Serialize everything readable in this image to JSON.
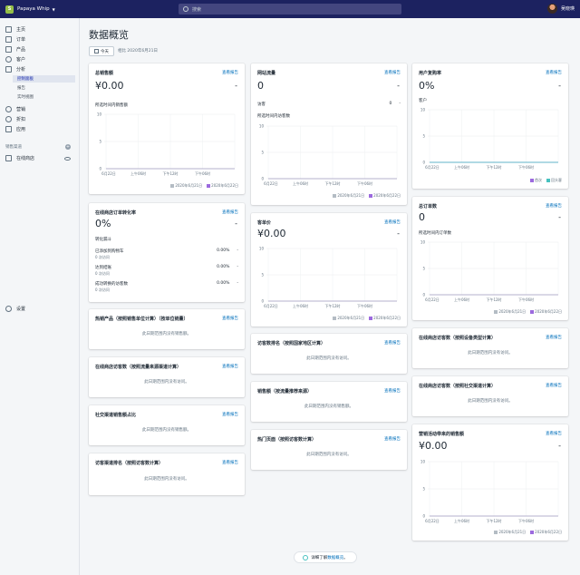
{
  "topbar": {
    "store_name": "Papaya Whip",
    "search_placeholder": "搜索",
    "user_name": "吴晓瑛"
  },
  "sidebar": {
    "items": [
      {
        "label": "主页",
        "icon": "home-icon"
      },
      {
        "label": "订单",
        "icon": "orders-icon"
      },
      {
        "label": "产品",
        "icon": "tag-icon"
      },
      {
        "label": "客户",
        "icon": "customers-icon"
      },
      {
        "label": "分析",
        "icon": "analytics-icon"
      },
      {
        "label": "营销",
        "icon": "marketing-icon"
      },
      {
        "label": "折扣",
        "icon": "discount-icon"
      },
      {
        "label": "应用",
        "icon": "apps-icon"
      }
    ],
    "sub_items": [
      "控制面板",
      "报告",
      "实时视图"
    ],
    "sales_channels_title": "销售渠道",
    "online_store": "在线商店",
    "settings": "设置"
  },
  "page": {
    "title": "数据概览",
    "date_button": "今天",
    "compare_text": "相比 2020年6月21日"
  },
  "common": {
    "view_report": "查看报告",
    "no_sales": "此日期范围内没有销售额。",
    "no_visits": "此日期范围内没有访问。",
    "legend_a": "2020年6月21日",
    "legend_b": "2020年6月22日",
    "dash": "-"
  },
  "cards": {
    "total_sales": {
      "title": "总销售额",
      "value": "¥0.00",
      "chart_label": "所选时间内销售额"
    },
    "traffic": {
      "title": "网站流量",
      "value": "0",
      "visitors_label": "访客",
      "visitors_value": "0",
      "chart_label": "所选时间内访客数"
    },
    "returning": {
      "title": "用户复购率",
      "value": "0%",
      "sub_label": "客户",
      "legend_a": "首次",
      "legend_b": "回头客"
    },
    "conversion": {
      "title": "在线商店订单转化率",
      "value": "0%",
      "funnel_title": "转化漏斗",
      "rows": [
        {
          "label": "已添加到购物车",
          "sub": "0 次访问",
          "pct": "0.00%"
        },
        {
          "label": "达到结账",
          "sub": "0 次访问",
          "pct": "0.00%"
        },
        {
          "label": "成功转换的访客数",
          "sub": "0 次访问",
          "pct": "0.00%"
        }
      ]
    },
    "aov": {
      "title": "客单价",
      "value": "¥0.00"
    },
    "total_orders": {
      "title": "总订单数",
      "value": "0",
      "chart_label": "所选时间内订单数"
    },
    "top_products": {
      "title": "热销产品（按照销售单位计算）（按单位销量）"
    },
    "visits_by_country": {
      "title": "访客数排名（按照国家地区计算）"
    },
    "visits_by_device": {
      "title": "在线商店访客数（按照设备类型计算）"
    },
    "visits_by_source": {
      "title": "在线商店访客数（按照流量来源渠道计算）"
    },
    "sales_by_referrer": {
      "title": "销售额（按流量推荐来源）"
    },
    "visits_by_social": {
      "title": "在线商店访客数（按照社交渠道计算）"
    },
    "social_sales": {
      "title": "社交渠道销售额占比"
    },
    "top_pages": {
      "title": "热门页面（按照访客数计算）"
    },
    "marketing_sales": {
      "title": "营销活动带来的销售额",
      "value": "¥0.00"
    },
    "visits_by_referrer": {
      "title": "访客渠道排名（按照访客数计算）"
    }
  },
  "chart_data": [
    {
      "id": "total_sales",
      "type": "line",
      "x": [
        "6月22日",
        "上午06时",
        "下午12时",
        "下午06时"
      ],
      "ylim": [
        0,
        10
      ],
      "yticks": [
        0,
        5,
        10
      ],
      "series": [
        {
          "name": "2020年6月21日",
          "values": [
            0,
            0,
            0,
            0
          ],
          "color": "#9c6ade"
        },
        {
          "name": "2020年6月22日",
          "values": [
            0,
            0,
            0,
            0
          ],
          "color": "#b4bcc4"
        }
      ]
    },
    {
      "id": "traffic",
      "type": "line",
      "x": [
        "6月22日",
        "上午06时",
        "下午12时",
        "下午06时"
      ],
      "ylim": [
        0,
        10
      ],
      "yticks": [
        0,
        5,
        10
      ],
      "series": [
        {
          "name": "2020年6月21日",
          "values": [
            0,
            0,
            0,
            0
          ],
          "color": "#9c6ade"
        },
        {
          "name": "2020年6月22日",
          "values": [
            0,
            0,
            0,
            0
          ],
          "color": "#b4bcc4"
        }
      ]
    },
    {
      "id": "returning",
      "type": "line",
      "x": [
        "6月22日",
        "上午06时",
        "下午12时",
        "下午06时"
      ],
      "ylim": [
        0,
        10
      ],
      "yticks": [
        0,
        5,
        10
      ],
      "series": [
        {
          "name": "首次",
          "values": [
            0,
            0,
            0,
            0
          ],
          "color": "#9c6ade"
        },
        {
          "name": "回头客",
          "values": [
            0,
            0,
            0,
            0
          ],
          "color": "#47c1bf"
        }
      ]
    },
    {
      "id": "aov",
      "type": "line",
      "x": [
        "6月22日",
        "上午06时",
        "下午12时",
        "下午06时"
      ],
      "ylim": [
        0,
        10
      ],
      "yticks": [
        0,
        5,
        10
      ],
      "series": [
        {
          "name": "2020年6月21日",
          "values": [
            0,
            0,
            0,
            0
          ],
          "color": "#9c6ade"
        },
        {
          "name": "2020年6月22日",
          "values": [
            0,
            0,
            0,
            0
          ],
          "color": "#b4bcc4"
        }
      ]
    },
    {
      "id": "total_orders",
      "type": "line",
      "x": [
        "6月22日",
        "上午06时",
        "下午12时",
        "下午06时"
      ],
      "ylim": [
        0,
        10
      ],
      "yticks": [
        0,
        5,
        10
      ],
      "series": [
        {
          "name": "2020年6月21日",
          "values": [
            0,
            0,
            0,
            0
          ],
          "color": "#9c6ade"
        },
        {
          "name": "2020年6月22日",
          "values": [
            0,
            0,
            0,
            0
          ],
          "color": "#b4bcc4"
        }
      ]
    },
    {
      "id": "marketing_sales",
      "type": "line",
      "x": [
        "6月22日",
        "上午06时",
        "下午12时",
        "下午06时"
      ],
      "ylim": [
        0,
        10
      ],
      "yticks": [
        0,
        5,
        10
      ],
      "series": [
        {
          "name": "2020年6月21日",
          "values": [
            0,
            0,
            0,
            0
          ],
          "color": "#9c6ade"
        },
        {
          "name": "2020年6月22日",
          "values": [
            0,
            0,
            0,
            0
          ],
          "color": "#b4bcc4"
        }
      ]
    }
  ],
  "footer": {
    "tip_prefix": "详细了解",
    "tip_link": "数据概览",
    "tip_suffix": "。"
  },
  "colors": {
    "topbar": "#1c2260",
    "link": "#006fbb",
    "series_a": "#9c6ade",
    "series_b": "#b4bcc4",
    "returning": "#47c1bf"
  }
}
